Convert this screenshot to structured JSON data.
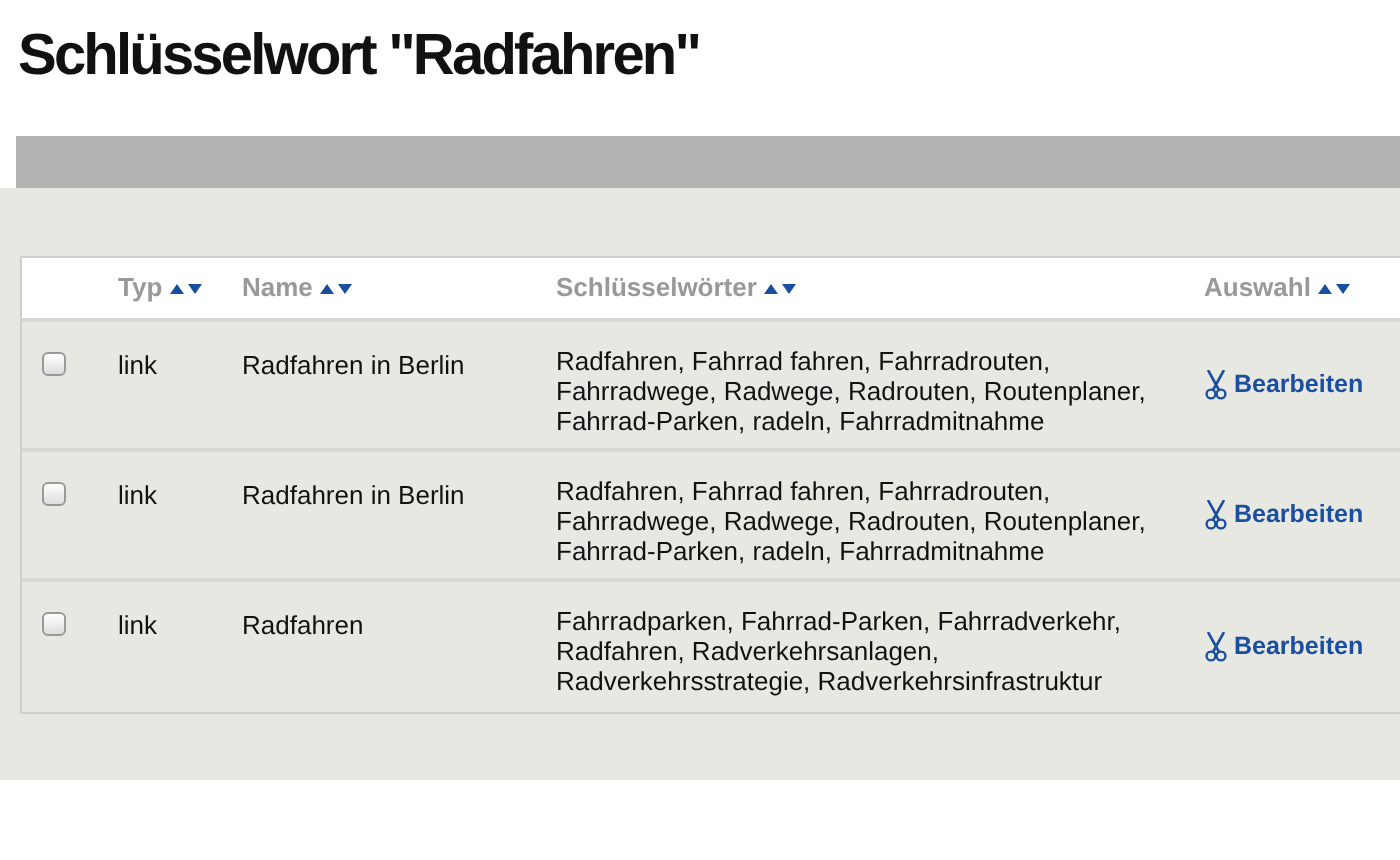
{
  "title": "Schlüsselwort \"Radfahren\"",
  "table": {
    "columns": [
      {
        "label": "Typ",
        "sortable": true
      },
      {
        "label": "Name",
        "sortable": true
      },
      {
        "label": "Schlüsselwörter",
        "sortable": true
      },
      {
        "label": "Auswahl",
        "sortable": true
      }
    ],
    "rows": [
      {
        "checked": false,
        "type": "link",
        "name": "Radfahren in Berlin",
        "keywords": "Radfahren, Fahrrad fahren, Fahrradrouten, Fahrradwege, Radwege, Radrouten, Routenplaner, Fahrrad-Parken, radeln, Fahrradmitnahme",
        "action": "Bearbeiten"
      },
      {
        "checked": false,
        "type": "link",
        "name": "Radfahren in Berlin",
        "keywords": "Radfahren, Fahrrad fahren, Fahrradrouten, Fahrradwege, Radwege, Radrouten, Routenplaner, Fahrrad-Parken, radeln, Fahrradmitnahme",
        "action": "Bearbeiten"
      },
      {
        "checked": false,
        "type": "link",
        "name": "Radfahren",
        "keywords": "Fahrradparken, Fahrrad-Parken, Fahrradverkehr, Radfahren, Radverkehrsanlagen, Radverkehrsstrategie, Radverkehrsinfrastruktur",
        "action": "Bearbeiten"
      }
    ]
  }
}
